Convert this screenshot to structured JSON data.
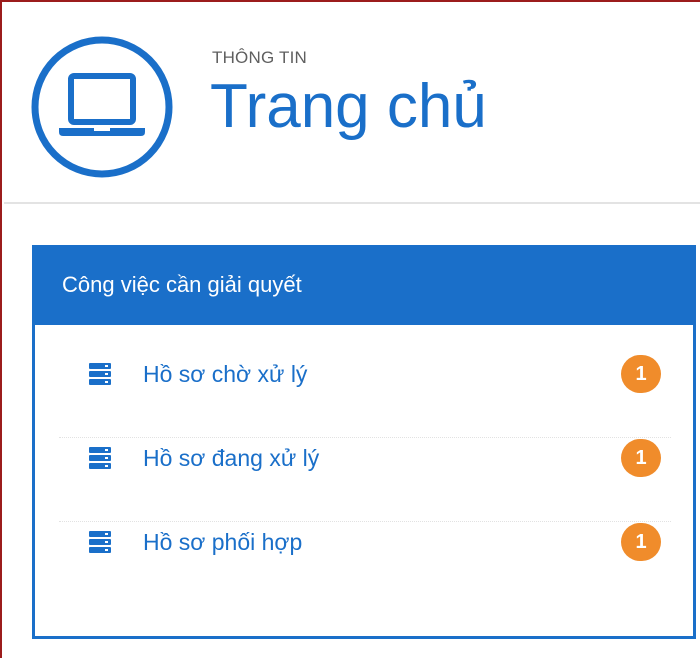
{
  "header": {
    "eyebrow": "THÔNG TIN",
    "title": "Trang chủ",
    "logo_icon": "laptop-icon"
  },
  "panel": {
    "title": "Công việc cần giải quyết",
    "items": [
      {
        "icon": "server-icon",
        "label": "Hồ sơ chờ xử lý",
        "count": "1"
      },
      {
        "icon": "server-icon",
        "label": "Hồ sơ đang xử lý",
        "count": "1"
      },
      {
        "icon": "server-icon",
        "label": "Hồ sơ phối hợp",
        "count": "1"
      }
    ]
  },
  "colors": {
    "primary": "#1a6fc9",
    "badge": "#f08c2b",
    "frame_border": "#9c1c1c"
  }
}
